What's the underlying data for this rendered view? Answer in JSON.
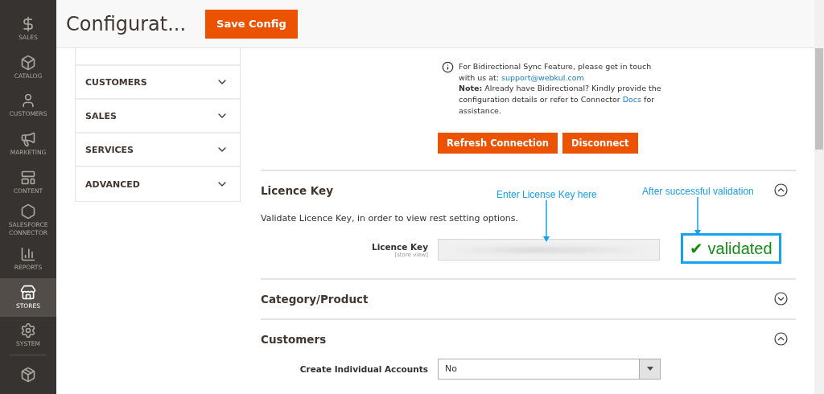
{
  "sidebar": {
    "items": [
      {
        "kind": "dollar",
        "label": "SALES",
        "selected": false
      },
      {
        "kind": "box",
        "label": "CATALOG",
        "selected": false
      },
      {
        "kind": "person",
        "label": "CUSTOMERS",
        "selected": false
      },
      {
        "kind": "megaphone",
        "label": "MARKETING",
        "selected": false
      },
      {
        "kind": "layout",
        "label": "CONTENT",
        "selected": false
      },
      {
        "kind": "hexagon",
        "label": "SALESFORCE CONNECTOR",
        "selected": false
      },
      {
        "kind": "chart",
        "label": "REPORTS",
        "selected": false
      },
      {
        "kind": "store",
        "label": "STORES",
        "selected": true
      },
      {
        "kind": "gear",
        "label": "SYSTEM",
        "selected": false
      },
      {
        "kind": "package",
        "selected": false
      }
    ]
  },
  "header": {
    "title": "Configurat...",
    "save_button": "Save Config"
  },
  "config_tabs": [
    {
      "label": "CUSTOMERS"
    },
    {
      "label": "SALES"
    },
    {
      "label": "SERVICES"
    },
    {
      "label": "ADVANCED"
    }
  ],
  "info": {
    "intro": "For Bidirectional Sync Feature, please get in touch with us at:",
    "email": "support@webkul.com",
    "note": "**Note:** Already have Bidirectional? Kindly provide the configuration details or refer to Connector",
    "docs_link": "Docs",
    "note_end": "for assistance."
  },
  "buttons": [
    "Refresh Connection",
    "Disconnect"
  ],
  "sections": [
    {
      "title": "Licence Key",
      "expanded": true,
      "description": "Validate Licence Key, in order to view rest setting options.",
      "fields": [
        {
          "kind": "text",
          "label": "Licence Key",
          "scope": "[store view]"
        }
      ],
      "status": "✔ validated",
      "annotations": [
        "Enter License Key here",
        "After successful validation"
      ]
    },
    {
      "title": "Category/Product",
      "expanded": false
    },
    {
      "title": "Customers",
      "expanded": true,
      "fields": [
        {
          "kind": "select",
          "label": "Create Individual Accounts",
          "value": "No"
        }
      ]
    }
  ]
}
